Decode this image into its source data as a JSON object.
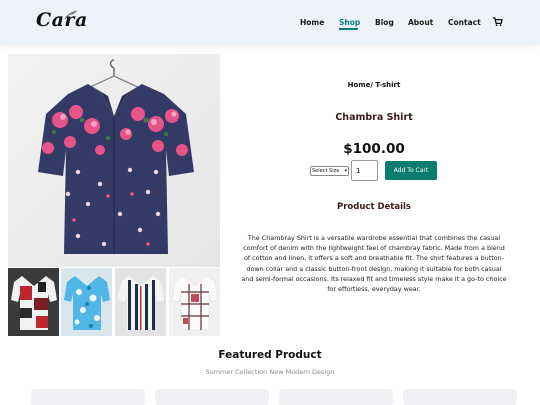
{
  "header": {
    "logo_text": "Cara",
    "nav": [
      {
        "label": "Home"
      },
      {
        "label": "Shop"
      },
      {
        "label": "Blog"
      },
      {
        "label": "About"
      },
      {
        "label": "Contact"
      }
    ],
    "active_nav": "Shop",
    "cart_icon": "cart-icon"
  },
  "product": {
    "breadcrumb": "Home/ T-shirt",
    "name": "Chambra Shirt",
    "price": "$100.00",
    "size_select": "Select Size",
    "quantity": "1",
    "add_to_cart": "Add To Cart",
    "details_heading": "Product Details",
    "description": "The Chambray Shirt is a versatile wardrobe essential that combines the casual comfort of denim with the lightweight feel of chambray fabric. Made from a blend of cotton and linen, it offers a soft and breathable fit. The shirt features a button-down collar and a classic button-front design, making it suitable for both casual and semi-formal occasions. Its relaxed fit and timeless style make it a go-to choice for effortless, everyday wear."
  },
  "featured": {
    "title": "Featured Product",
    "subtitle": "Summer Collection New Modern Design"
  },
  "colors": {
    "accent": "#088178",
    "button": "#0b7d6e",
    "header_bg": "#eef3fb",
    "heading_text": "#3b1a1a"
  }
}
